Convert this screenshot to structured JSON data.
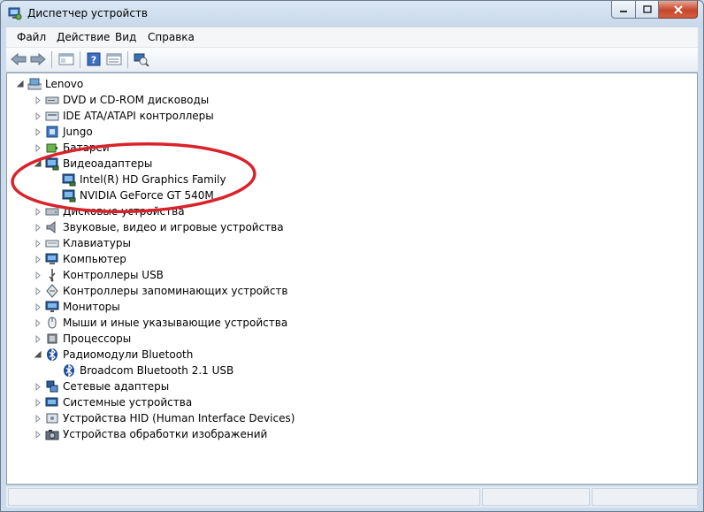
{
  "window": {
    "title": "Диспетчер устройств"
  },
  "menu": [
    "Файл",
    "Действие",
    "Вид",
    "Справка"
  ],
  "tree": {
    "root": "Lenovo",
    "items": [
      {
        "label": "DVD и CD-ROM дисководы",
        "icon": "dvd-drive-icon",
        "expanded": false
      },
      {
        "label": "IDE ATA/ATAPI контроллеры",
        "icon": "ide-controller-icon",
        "expanded": false
      },
      {
        "label": "Jungo",
        "icon": "jungo-device-icon",
        "expanded": false
      },
      {
        "label": "Батареи",
        "icon": "battery-icon",
        "expanded": false
      },
      {
        "label": "Видеоадаптеры",
        "icon": "display-adapter-icon",
        "expanded": true,
        "children": [
          "Intel(R) HD Graphics Family",
          "NVIDIA GeForce GT 540M"
        ]
      },
      {
        "label": "Дисковые устройства",
        "icon": "disk-drive-icon",
        "expanded": false
      },
      {
        "label": "Звуковые, видео и игровые устройства",
        "icon": "speaker-icon",
        "expanded": false
      },
      {
        "label": "Клавиатуры",
        "icon": "keyboard-icon",
        "expanded": false
      },
      {
        "label": "Компьютер",
        "icon": "computer-icon",
        "expanded": false
      },
      {
        "label": "Контроллеры USB",
        "icon": "usb-icon",
        "expanded": false
      },
      {
        "label": "Контроллеры запоминающих устройств",
        "icon": "storage-controller-icon",
        "expanded": false
      },
      {
        "label": "Мониторы",
        "icon": "monitor-icon",
        "expanded": false
      },
      {
        "label": "Мыши и иные указывающие устройства",
        "icon": "mouse-icon",
        "expanded": false
      },
      {
        "label": "Процессоры",
        "icon": "processor-icon",
        "expanded": false
      },
      {
        "label": "Радиомодули Bluetooth",
        "icon": "bluetooth-icon",
        "expanded": true,
        "children": [
          "Broadcom Bluetooth 2.1 USB"
        ]
      },
      {
        "label": "Сетевые адаптеры",
        "icon": "network-adapter-icon",
        "expanded": false
      },
      {
        "label": "Системные устройства",
        "icon": "system-device-icon",
        "expanded": false
      },
      {
        "label": "Устройства HID (Human Interface Devices)",
        "icon": "hid-icon",
        "expanded": false
      },
      {
        "label": "Устройства обработки изображений",
        "icon": "camera-icon",
        "expanded": false
      }
    ]
  },
  "colors": {
    "highlight_ellipse": "#d9232a",
    "title_bar": "#c7d8ea",
    "close_button": "#c7462d"
  }
}
